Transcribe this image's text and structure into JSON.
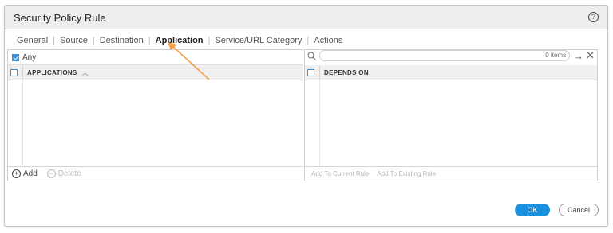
{
  "dialog": {
    "title": "Security Policy Rule",
    "help_icon": "?"
  },
  "tabs": [
    "General",
    "Source",
    "Destination",
    "Application",
    "Service/URL Category",
    "Actions"
  ],
  "active_tab": "Application",
  "left_panel": {
    "any_label": "Any",
    "any_checked": true,
    "column_header": "APPLICATIONS",
    "add_label": "Add",
    "delete_label": "Delete"
  },
  "right_panel": {
    "search_count": "0 items",
    "column_header": "DEPENDS ON",
    "add_to_current": "Add To Current Rule",
    "add_to_existing": "Add To Existing Rule"
  },
  "buttons": {
    "ok": "OK",
    "cancel": "Cancel"
  },
  "colors": {
    "accent": "#1a8fe0",
    "annotation_arrow": "#f5a04a"
  }
}
